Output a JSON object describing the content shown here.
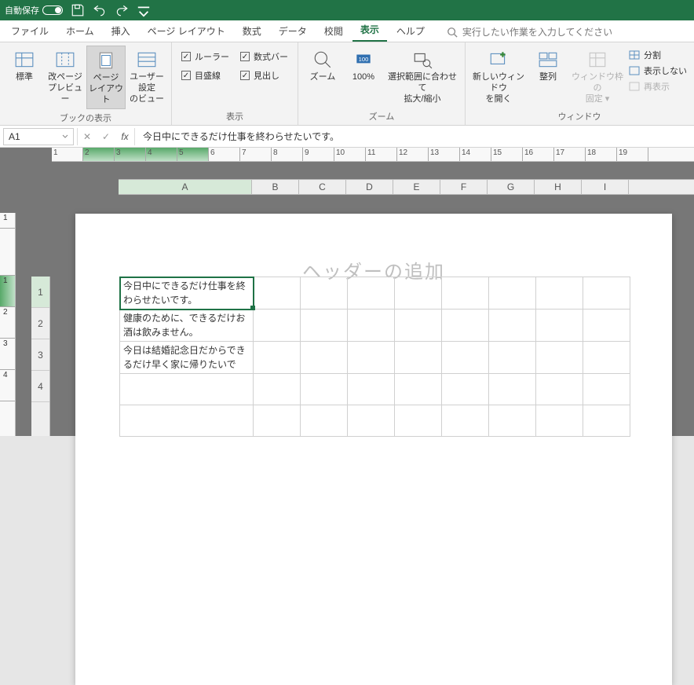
{
  "titlebar": {
    "autosave_label": "自動保存",
    "autosave_state": "オフ"
  },
  "menus": {
    "file": "ファイル",
    "home": "ホーム",
    "insert": "挿入",
    "pagelayout": "ページ レイアウト",
    "formulas": "数式",
    "data": "データ",
    "review": "校閲",
    "view": "表示",
    "help": "ヘルプ",
    "tellme": "実行したい作業を入力してください"
  },
  "ribbon": {
    "views": {
      "normal": "標準",
      "pagebreak": "改ページ\nプレビュー",
      "pagelayout": "ページ\nレイアウト",
      "custom": "ユーザー設定\nのビュー",
      "group": "ブックの表示"
    },
    "show": {
      "ruler": "ルーラー",
      "formulabar": "数式バー",
      "gridlines": "目盛線",
      "headings": "見出し",
      "group": "表示"
    },
    "zoom": {
      "zoom": "ズーム",
      "hundred": "100%",
      "fitsel": "選択範囲に合わせて\n拡大/縮小",
      "group": "ズーム"
    },
    "window": {
      "newwin": "新しいウィンドウ\nを開く",
      "arrange": "整列",
      "freeze": "ウィンドウ枠の\n固定 ▾",
      "split": "分割",
      "hide": "表示しない",
      "unhide": "再表示",
      "group": "ウィンドウ"
    }
  },
  "formula_bar": {
    "cell_ref": "A1",
    "formula": "今日中にできるだけ仕事を終わらせたいです。"
  },
  "ruler_h": [
    "1",
    "2",
    "3",
    "4",
    "5",
    "6",
    "7",
    "8",
    "9",
    "10",
    "11",
    "12",
    "13",
    "14",
    "15",
    "16",
    "17",
    "18",
    "19"
  ],
  "columns": [
    "A",
    "B",
    "C",
    "D",
    "E",
    "F",
    "G",
    "H",
    "I"
  ],
  "rows": [
    "1",
    "2",
    "3",
    "4"
  ],
  "header_placeholder": "ヘッダーの追加",
  "cells": {
    "A1": "今日中にできるだけ仕事を終わらせたいです。",
    "A2": "健康のために、できるだけお酒は飲みません。",
    "A3": "今日は結婚記念日だからできるだけ早く家に帰りたいで"
  },
  "vruler": [
    "1",
    "",
    "1",
    "2",
    "3",
    "4"
  ]
}
